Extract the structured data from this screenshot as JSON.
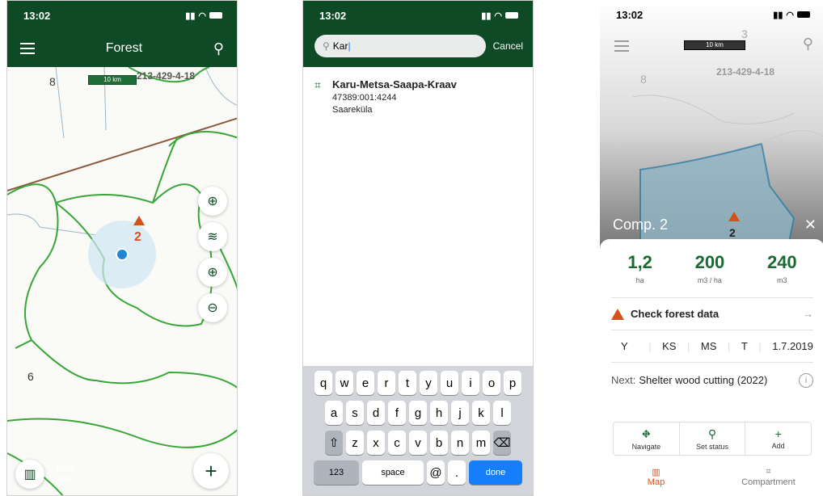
{
  "status": {
    "time": "13:02"
  },
  "screen1": {
    "title": "Forest",
    "scale": "10 km",
    "compartment_labels": [
      "8",
      "213-429-4-18",
      "6",
      "2"
    ],
    "basemap_label": "Base map",
    "add_label": "+"
  },
  "screen2": {
    "search_value": "Kar",
    "cancel_label": "Cancel",
    "result": {
      "title": "Karu-Metsa-Saapa-Kraav",
      "code": "47389:001:4244",
      "place": "Saareküla"
    },
    "keyboard": {
      "row1": [
        "q",
        "w",
        "e",
        "r",
        "t",
        "y",
        "u",
        "i",
        "o",
        "p"
      ],
      "row2": [
        "a",
        "s",
        "d",
        "f",
        "g",
        "h",
        "j",
        "k",
        "l"
      ],
      "row3": [
        "z",
        "x",
        "c",
        "v",
        "b",
        "n",
        "m"
      ],
      "num_key": "123",
      "space_key": "space",
      "at_key": "@",
      "dot_key": ".",
      "done_key": "done"
    }
  },
  "screen3": {
    "scale": "10 km",
    "map_labels": [
      "8",
      "3",
      "213-429-4-18",
      "2"
    ],
    "comp_title": "Comp. 2",
    "metrics": [
      {
        "value": "1,2",
        "unit": "ha"
      },
      {
        "value": "200",
        "unit": "m3 / ha"
      },
      {
        "value": "240",
        "unit": "m3"
      }
    ],
    "warning": "Check forest data",
    "attrs": [
      "Y",
      "KS",
      "MS",
      "T",
      "1.7.2019"
    ],
    "next_label": "Next:",
    "next_value": "Shelter wood cutting (2022)",
    "actions": [
      "Navigate",
      "Set status",
      "Add"
    ],
    "tabs": [
      "Map",
      "Compartment"
    ]
  },
  "colors": {
    "brand_green": "#0d4a25",
    "accent_orange": "#d9531e",
    "forest_line": "#3aa63a"
  }
}
